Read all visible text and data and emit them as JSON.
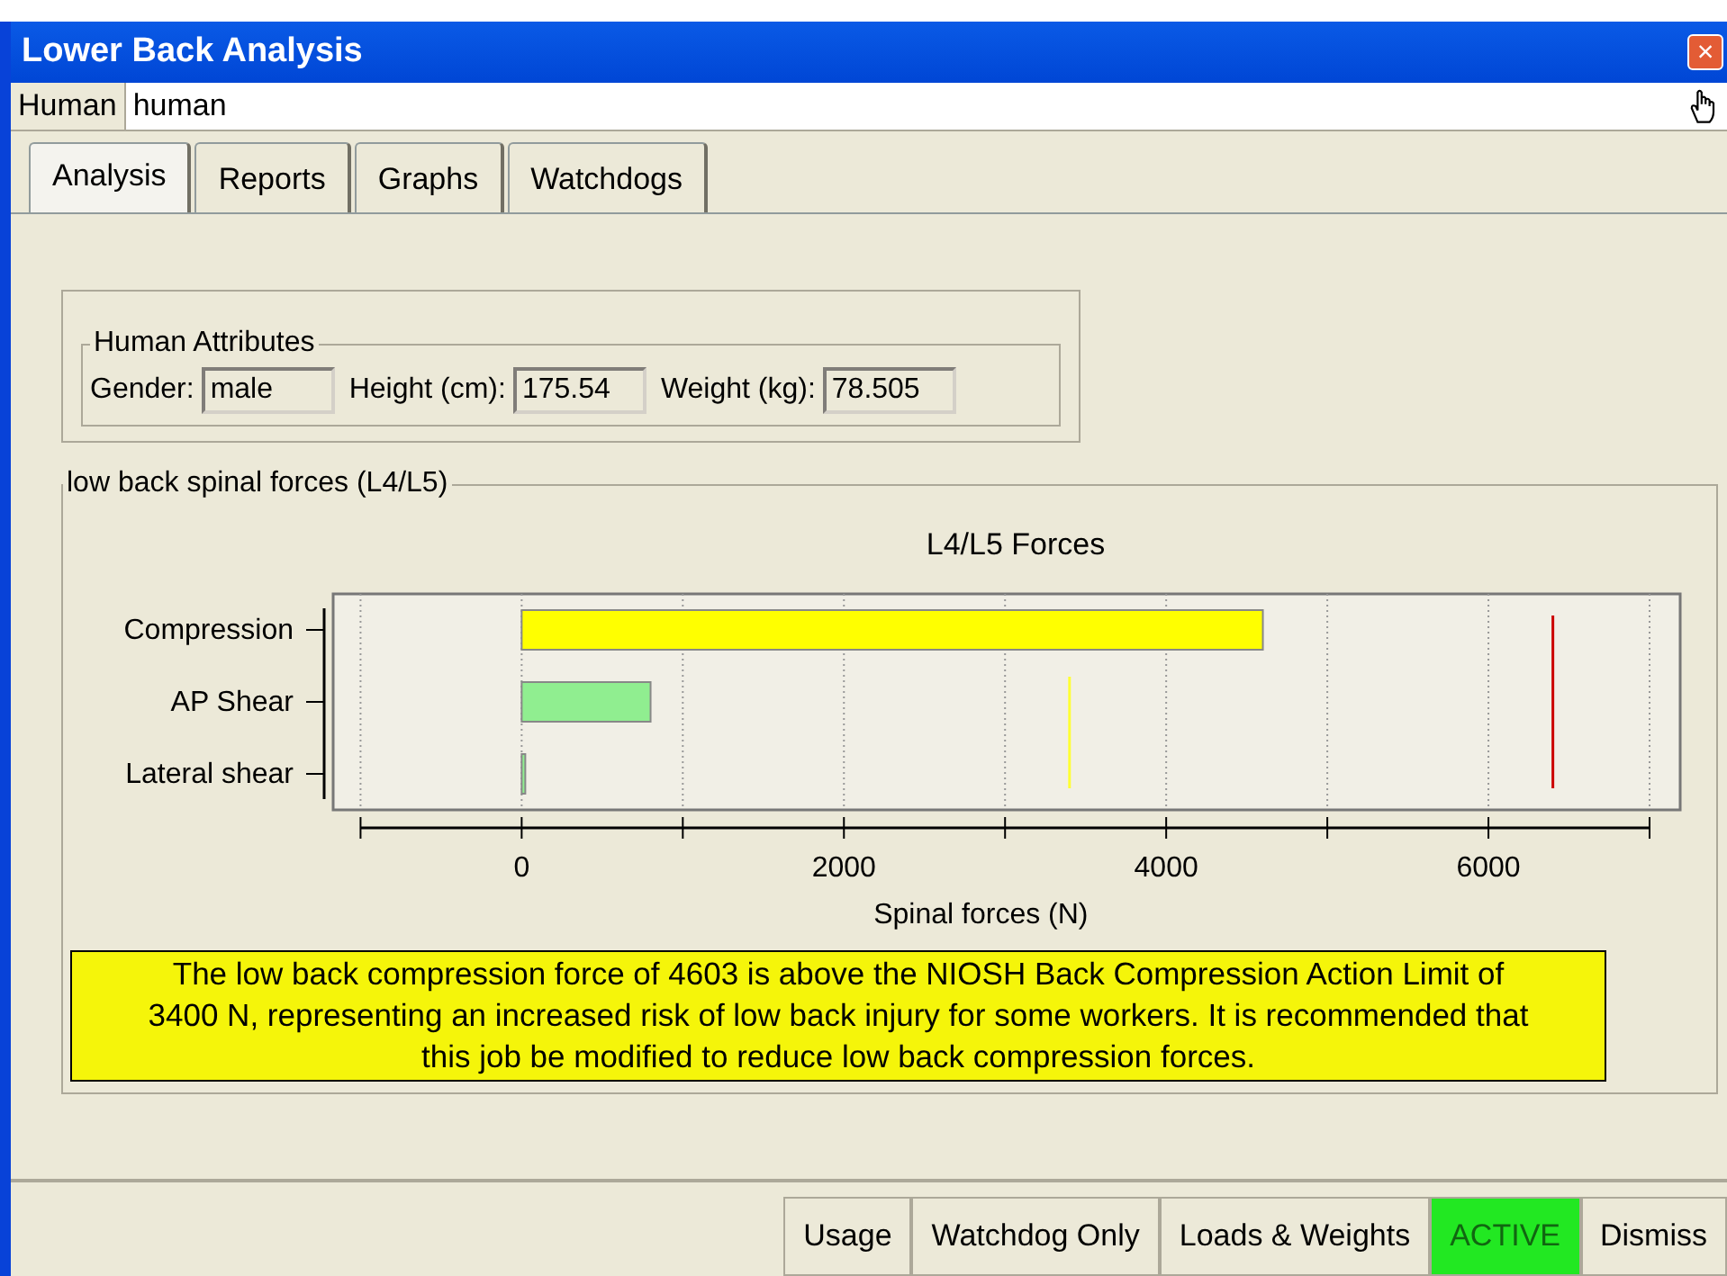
{
  "window": {
    "title": "Lower Back Analysis",
    "close": "×"
  },
  "object_row": {
    "label": "Human",
    "value": "human"
  },
  "tabs": [
    {
      "label": "Analysis",
      "selected": true
    },
    {
      "label": "Reports",
      "selected": false
    },
    {
      "label": "Graphs",
      "selected": false
    },
    {
      "label": "Watchdogs",
      "selected": false
    }
  ],
  "human_attributes": {
    "title": "Human Attributes",
    "fields": [
      {
        "label": "Gender:",
        "value": "male"
      },
      {
        "label": "Height (cm):",
        "value": "175.54"
      },
      {
        "label": "Weight (kg):",
        "value": "78.505"
      }
    ]
  },
  "forces": {
    "title": "low back spinal forces (L4/L5)",
    "chart_data": {
      "type": "bar",
      "orientation": "horizontal",
      "grid": true,
      "title": "L4/L5 Forces",
      "xlabel": "Spinal forces (N)",
      "categories": [
        "Compression",
        "AP Shear",
        "Lateral shear"
      ],
      "xlim": [
        -1170,
        7190
      ],
      "xticks": [
        0,
        2000,
        4000,
        6000
      ],
      "series": [
        {
          "color": "#ffff00",
          "values": [
            4600,
            null,
            null
          ]
        },
        {
          "color": "#90ee90",
          "values": [
            null,
            800,
            10
          ]
        }
      ],
      "ref_lines": [
        {
          "axis": "x",
          "value": 3400,
          "color": "#ffff33"
        },
        {
          "axis": "x",
          "value": 6400,
          "color": "#cc0000"
        }
      ]
    },
    "message": "The low back compression force of 4603 is above the NIOSH Back Compression Action Limit of 3400 N, representing an increased risk of low back injury for some workers. It is recommended that this job be modified to reduce low back compression forces."
  },
  "status_buttons": [
    {
      "label": "Usage",
      "highlighted": false
    },
    {
      "label": "Watchdog Only",
      "highlighted": false
    },
    {
      "label": "Loads & Weights",
      "highlighted": false
    },
    {
      "label": "ACTIVE",
      "highlighted": true
    },
    {
      "label": "Dismiss",
      "highlighted": false
    }
  ]
}
